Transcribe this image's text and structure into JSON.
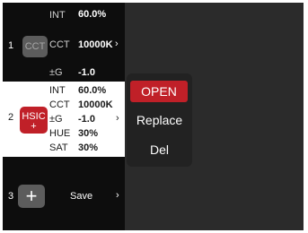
{
  "preset1": {
    "index": "1",
    "thumb_label": "CCT",
    "int_label": "INT",
    "int_value": "60.0%",
    "cct_label": "CCT",
    "cct_value": "10000K",
    "chevron": "›",
    "g_label": "±G",
    "g_value": "-1.0"
  },
  "preset2": {
    "index": "2",
    "thumb_label": "HSIC",
    "thumb_sub": "+",
    "int_label": "INT",
    "int_value": "60.0%",
    "cct_label": "CCT",
    "cct_value": "10000K",
    "g_label": "±G",
    "g_value": "-1.0",
    "chevron": "›",
    "hue_label": "HUE",
    "hue_value": "30%",
    "sat_label": "SAT",
    "sat_value": "30%"
  },
  "preset3": {
    "index": "3",
    "add_icon": "+",
    "save_label": "Save",
    "chevron": "›"
  },
  "menu": {
    "open_label": "OPEN",
    "replace_label": "Replace",
    "delete_label": "Del"
  },
  "colors": {
    "accent_red": "#c02028",
    "panel_dark": "#0d0d0d",
    "pane_gray": "#2b2b2b"
  }
}
